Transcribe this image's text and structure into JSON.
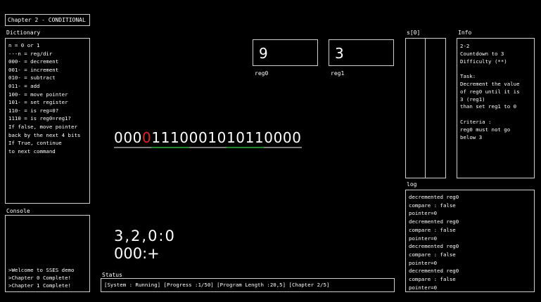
{
  "header": {
    "title": "Chapter 2 - CONDITIONAL"
  },
  "dictionary": {
    "label": "Dictionary",
    "lines": [
      "n = 0 or 1",
      "---n = reg/dir",
      "000- = decrement",
      "001- = increment",
      "010- = subtract",
      "011- = add",
      "100- = move pointer",
      "101- = set register",
      "110- = is reg=0?",
      "1110 = is reg0=reg1?",
      "If false, move pointer",
      "back by the next 4 bits",
      "If True, continue",
      "to next command"
    ]
  },
  "console": {
    "label": "Console",
    "lines": [
      ">Welcome to SSES demo",
      ">Chapter 0 Complete!",
      ">Chapter 1 Complete!"
    ]
  },
  "registers": {
    "reg0": {
      "value": "9",
      "label": "reg0"
    },
    "reg1": {
      "value": "3",
      "label": "reg1"
    }
  },
  "program": {
    "bits": [
      "0",
      "0",
      "0",
      "0",
      "1",
      "1",
      "1",
      "0",
      "0",
      "0",
      "1",
      "0",
      "1",
      "0",
      "1",
      "1",
      "0",
      "0",
      "0",
      "0"
    ],
    "highlight_index": 3,
    "highlight_color": "#e02424",
    "underline_groups": [
      {
        "start": 0,
        "end": 3,
        "color": "#7a7a7a"
      },
      {
        "start": 4,
        "end": 7,
        "color": "#1f8a2a"
      },
      {
        "start": 8,
        "end": 11,
        "color": "#7a7a7a"
      },
      {
        "start": 12,
        "end": 15,
        "color": "#1f8a2a"
      },
      {
        "start": 16,
        "end": 19,
        "color": "#7a7a7a"
      }
    ]
  },
  "pointer_readout": "3,2,0:0",
  "command_readout": "000:+",
  "status": {
    "label": "Status",
    "text": "[System : Running] [Progress :1/50] [Program Length :20,5] [Chapter 2/5]"
  },
  "stack": {
    "label": "s[0]"
  },
  "info": {
    "label": "Info",
    "lines": [
      "2-2",
      "Countdown to 3",
      "Difficulty (**)",
      "",
      "Task:",
      "Decrement the value",
      "of reg0 until it is",
      "3 (reg1)",
      "than set reg1 to 0",
      "",
      "Criteria :",
      "reg0 must not go",
      "below 3"
    ]
  },
  "log": {
    "label": "log",
    "lines": [
      "decremented reg0",
      "compare : false",
      "pointer=0",
      "decremented reg0",
      "compare : false",
      "pointer=0",
      "decremented reg0",
      "compare : false",
      "pointer=0",
      "decremented reg0",
      "compare : false",
      "pointer=0"
    ]
  }
}
